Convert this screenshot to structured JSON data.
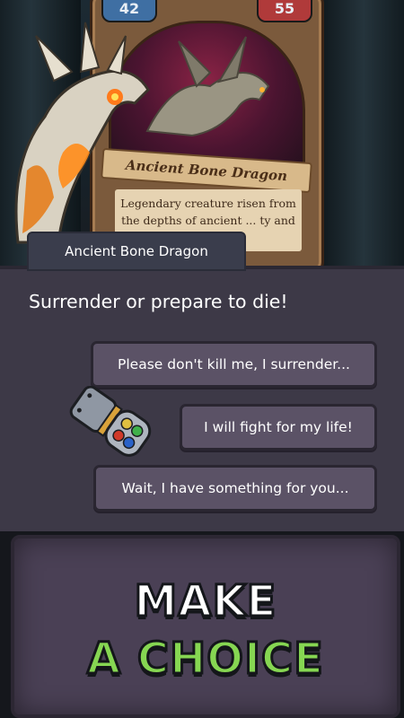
{
  "card": {
    "attack": "42",
    "defense": "55",
    "name": "Ancient Bone Dragon",
    "description": "Legendary creature risen from the depths of ancient ... ty and ... s age)"
  },
  "dialog": {
    "speaker": "Ancient Bone Dragon",
    "prompt": "Surrender or prepare to die!",
    "choices": [
      "Please don't kill me, I surrender...",
      "I will fight for my life!",
      "Wait, I have something for you..."
    ]
  },
  "cta": {
    "line1": "MAKE",
    "line2": "A CHOICE"
  },
  "colors": {
    "dialog_bg": "#3d3947",
    "choice_bg": "#5b5266",
    "cta_green": "#86d652"
  }
}
